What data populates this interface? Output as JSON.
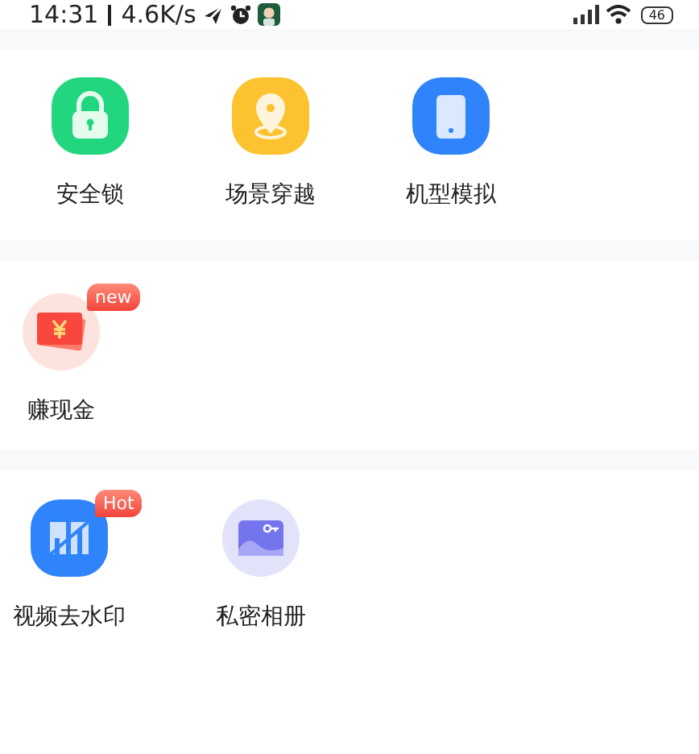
{
  "status_bar": {
    "time": "14:31",
    "network_speed": "4.6K/s",
    "battery": "46"
  },
  "sections": [
    {
      "items": [
        {
          "label": "安全锁",
          "kind": "lock"
        },
        {
          "label": "场景穿越",
          "kind": "location"
        },
        {
          "label": "机型模拟",
          "kind": "device"
        }
      ]
    },
    {
      "items": [
        {
          "label": "赚现金",
          "kind": "cash",
          "badge": "new"
        }
      ]
    },
    {
      "items": [
        {
          "label": "视频去水印",
          "kind": "watermark",
          "badge": "Hot"
        },
        {
          "label": "私密相册",
          "kind": "album"
        }
      ]
    }
  ]
}
